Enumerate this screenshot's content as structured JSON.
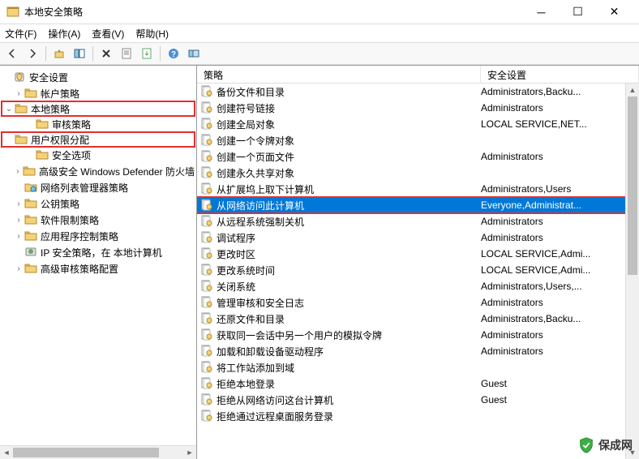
{
  "title": "本地安全策略",
  "menu": {
    "file": "文件(F)",
    "action": "操作(A)",
    "view": "查看(V)",
    "help": "帮助(H)"
  },
  "tree": {
    "root": "安全设置",
    "items": [
      {
        "label": "帐户策略",
        "indent": 1,
        "toggle": "›",
        "icon": "folder"
      },
      {
        "label": "本地策略",
        "indent": 1,
        "toggle": "⌄",
        "icon": "folder",
        "hl": true
      },
      {
        "label": "审核策略",
        "indent": 2,
        "toggle": "",
        "icon": "folder"
      },
      {
        "label": "用户权限分配",
        "indent": 2,
        "toggle": "",
        "icon": "folder",
        "hl": true
      },
      {
        "label": "安全选项",
        "indent": 2,
        "toggle": "",
        "icon": "folder"
      },
      {
        "label": "高级安全 Windows Defender 防火墙",
        "indent": 1,
        "toggle": "›",
        "icon": "folder"
      },
      {
        "label": "网络列表管理器策略",
        "indent": 1,
        "toggle": "",
        "icon": "folder-net"
      },
      {
        "label": "公钥策略",
        "indent": 1,
        "toggle": "›",
        "icon": "folder"
      },
      {
        "label": "软件限制策略",
        "indent": 1,
        "toggle": "›",
        "icon": "folder"
      },
      {
        "label": "应用程序控制策略",
        "indent": 1,
        "toggle": "›",
        "icon": "folder"
      },
      {
        "label": "IP 安全策略，在 本地计算机",
        "indent": 1,
        "toggle": "",
        "icon": "ip"
      },
      {
        "label": "高级审核策略配置",
        "indent": 1,
        "toggle": "›",
        "icon": "folder"
      }
    ]
  },
  "columns": {
    "policy": "策略",
    "setting": "安全设置"
  },
  "rows": [
    {
      "policy": "备份文件和目录",
      "setting": "Administrators,Backu..."
    },
    {
      "policy": "创建符号链接",
      "setting": "Administrators"
    },
    {
      "policy": "创建全局对象",
      "setting": "LOCAL SERVICE,NET..."
    },
    {
      "policy": "创建一个令牌对象",
      "setting": ""
    },
    {
      "policy": "创建一个页面文件",
      "setting": "Administrators"
    },
    {
      "policy": "创建永久共享对象",
      "setting": ""
    },
    {
      "policy": "从扩展坞上取下计算机",
      "setting": "Administrators,Users"
    },
    {
      "policy": "从网络访问此计算机",
      "setting": "Everyone,Administrat...",
      "selected": true,
      "hl": true
    },
    {
      "policy": "从远程系统强制关机",
      "setting": "Administrators"
    },
    {
      "policy": "调试程序",
      "setting": "Administrators"
    },
    {
      "policy": "更改时区",
      "setting": "LOCAL SERVICE,Admi..."
    },
    {
      "policy": "更改系统时间",
      "setting": "LOCAL SERVICE,Admi..."
    },
    {
      "policy": "关闭系统",
      "setting": "Administrators,Users,..."
    },
    {
      "policy": "管理审核和安全日志",
      "setting": "Administrators"
    },
    {
      "policy": "还原文件和目录",
      "setting": "Administrators,Backu..."
    },
    {
      "policy": "获取同一会话中另一个用户的模拟令牌",
      "setting": "Administrators"
    },
    {
      "policy": "加载和卸载设备驱动程序",
      "setting": "Administrators"
    },
    {
      "policy": "将工作站添加到域",
      "setting": ""
    },
    {
      "policy": "拒绝本地登录",
      "setting": "Guest"
    },
    {
      "policy": "拒绝从网络访问这台计算机",
      "setting": "Guest"
    },
    {
      "policy": "拒绝通过远程桌面服务登录",
      "setting": ""
    }
  ],
  "watermark": "保成网"
}
